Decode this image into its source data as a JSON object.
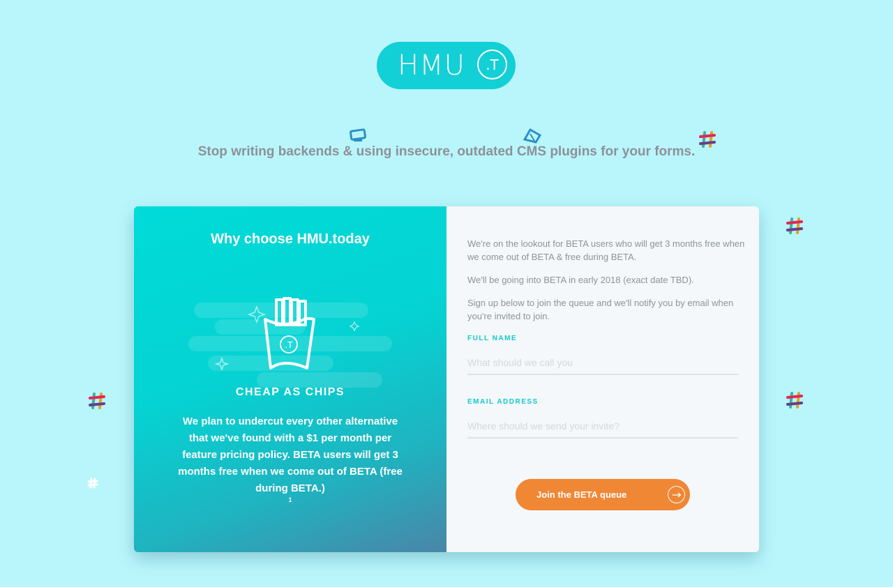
{
  "logo": {
    "text": "HMU",
    "badge": ".T",
    "color": "#13cfd6"
  },
  "tagline": "Stop writing backends & using insecure, outdated CMS plugins for your forms.",
  "left_panel": {
    "title": "Why choose HMU.today",
    "feature_icon": "fries-icon",
    "feature_badge": ".T",
    "feature_title": "CHEAP AS CHIPS",
    "feature_desc": "We plan to undercut every other alternative that we've found with a $1 per month per feature pricing policy. BETA users will get 3 months free when we come out of BETA (free during BETA.)",
    "pager": "1"
  },
  "right_panel": {
    "intro": [
      "We're on the lookout for BETA users who will get 3 months free when we come out of BETA & free during BETA.",
      "We'll be going into BETA in early 2018 (exact date TBD).",
      "Sign up below to join the queue and we'll notify you by email when you're invited to join."
    ],
    "form": {
      "name_label": "FULL NAME",
      "name_placeholder": "What should we call you",
      "email_label": "EMAIL ADDRESS",
      "email_placeholder": "Where should we send your invite?",
      "submit_label": "Join the BETA queue",
      "submit_icon": "arrow-right-icon"
    }
  },
  "decorations": [
    "slack-logo-icon",
    "form-icon",
    "tag-icon",
    "sparkle-icon"
  ],
  "colors": {
    "background": "#b9f6fc",
    "accent": "#13cfd6",
    "button": "#ef8735",
    "text_muted": "#8c9199"
  }
}
